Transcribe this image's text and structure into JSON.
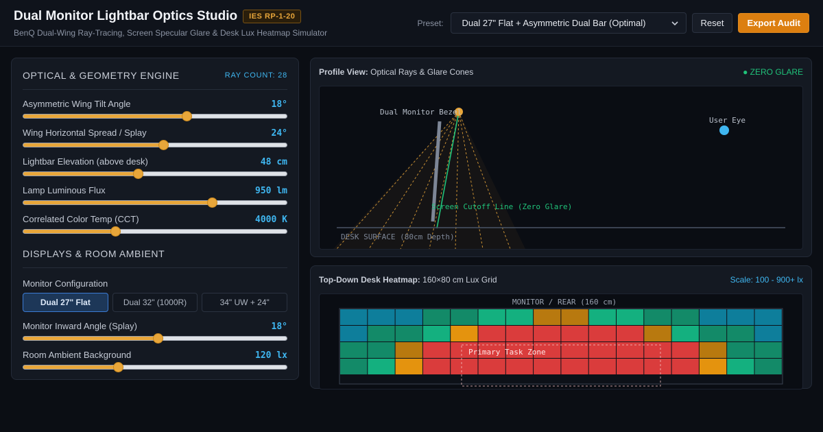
{
  "header": {
    "title": "Dual Monitor Lightbar Optics Studio",
    "badge": "IES RP-1-20",
    "subtitle": "BenQ Dual-Wing Ray-Tracing, Screen Specular Glare & Desk Lux Heatmap Simulator",
    "preset_label": "Preset:",
    "preset_value": "Dual 27\" Flat + Asymmetric Dual Bar (Optimal)",
    "reset_label": "Reset",
    "export_label": "Export Audit"
  },
  "engine": {
    "title": "OPTICAL & GEOMETRY ENGINE",
    "ray_count": "RAY COUNT: 28",
    "sliders": [
      {
        "label": "Asymmetric Wing Tilt Angle",
        "value": "18°",
        "fraction": 0.62
      },
      {
        "label": "Wing Horizontal Spread / Splay",
        "value": "24°",
        "fraction": 0.53
      },
      {
        "label": "Lightbar Elevation (above desk)",
        "value": "48 cm",
        "fraction": 0.435
      },
      {
        "label": "Lamp Luminous Flux",
        "value": "950 lm",
        "fraction": 0.715
      },
      {
        "label": "Correlated Color Temp (CCT)",
        "value": "4000 K",
        "fraction": 0.35
      }
    ]
  },
  "displays": {
    "title": "DISPLAYS & ROOM AMBIENT",
    "monitor_label": "Monitor Configuration",
    "options": [
      "Dual 27\" Flat",
      "Dual 32\" (1000R)",
      "34\" UW + 24\""
    ],
    "selected_index": 0,
    "sliders": [
      {
        "label": "Monitor Inward Angle (Splay)",
        "value": "18°",
        "fraction": 0.51
      },
      {
        "label": "Room Ambient Background",
        "value": "120 lx",
        "fraction": 0.36
      }
    ]
  },
  "profile": {
    "title_bold": "Profile View:",
    "title_rest": "Optical Rays & Glare Cones",
    "status": "● ZERO GLARE",
    "labels": {
      "monitor_bezel": "Dual Monitor Bezel",
      "user_eye": "User Eye",
      "cutoff": "Screen Cutoff Line (Zero Glare)",
      "desk": "DESK SURFACE (80cm Depth)"
    },
    "colors": {
      "ray": "#e8a63a",
      "cutoff": "#20c27a",
      "eye": "#3fb6f0",
      "monitor": "#7d8696"
    }
  },
  "heatmap": {
    "title_bold": "Top-Down Desk Heatmap:",
    "title_rest": "160×80 cm Lux Grid",
    "scale": "Scale: 100 - 900+ lx",
    "top_label": "MONITOR / REAR (160 cm)",
    "zone_label": "Primary Task Zone",
    "palette": {
      "C": "#0e7e9b",
      "T": "#138a68",
      "G": "#14b07f",
      "A": "#b8790f",
      "O": "#e4930e",
      "R": "#da3c3c"
    },
    "rows": [
      "CCCTTGGAAGGTTCCC",
      "CTTGORRRRRRAGTTC",
      "TTARRRRRRRRRRATT",
      "TGORRRRRRRRRROGT"
    ]
  }
}
